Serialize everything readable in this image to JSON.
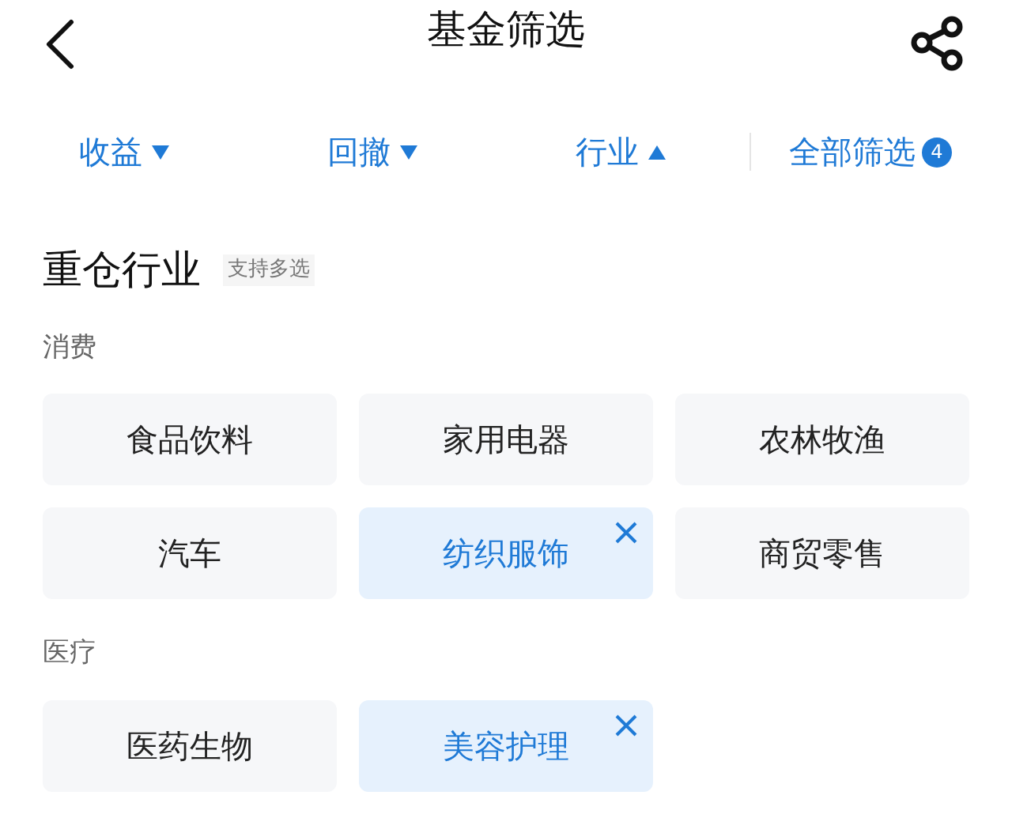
{
  "header": {
    "title": "基金筛选"
  },
  "filters": [
    {
      "label": "收益",
      "expanded": false
    },
    {
      "label": "回撤",
      "expanded": false
    },
    {
      "label": "行业",
      "expanded": true
    }
  ],
  "all_filters": {
    "label": "全部筛选",
    "badge": "4"
  },
  "section": {
    "title": "重仓行业",
    "hint": "支持多选"
  },
  "groups": [
    {
      "title": "消费",
      "options": [
        {
          "label": "食品饮料",
          "selected": false
        },
        {
          "label": "家用电器",
          "selected": false
        },
        {
          "label": "农林牧渔",
          "selected": false
        },
        {
          "label": "汽车",
          "selected": false
        },
        {
          "label": "纺织服饰",
          "selected": true
        },
        {
          "label": "商贸零售",
          "selected": false
        }
      ]
    },
    {
      "title": "医疗",
      "options": [
        {
          "label": "医药生物",
          "selected": false
        },
        {
          "label": "美容护理",
          "selected": true
        }
      ]
    }
  ]
}
